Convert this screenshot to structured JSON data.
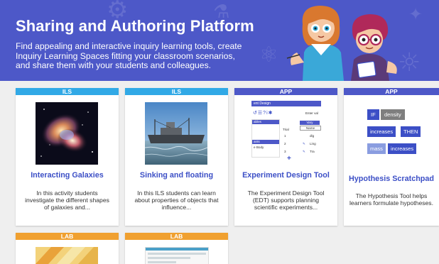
{
  "hero": {
    "title": "Sharing and Authoring Platform",
    "line1": "Find appealing and interactive inquiry learning tools, create",
    "line2": "Inquiry Learning Spaces fitting your classroom scenarios,",
    "line3": "and share them with your students and colleagues."
  },
  "cards": [
    {
      "tag": "ILS",
      "title": "Interacting Galaxies",
      "desc": [
        "In this activity students",
        "investigate the different shapes",
        "of galaxies and..."
      ]
    },
    {
      "tag": "ILS",
      "title": "Sinking and floating",
      "desc": [
        "In this ILS students can learn",
        "about properties of objects that",
        "influence..."
      ]
    },
    {
      "tag": "APP",
      "title": "Experiment Design Tool",
      "desc": [
        "The Experiment Design Tool",
        "(EDT) supports planning",
        "scientific experiments..."
      ]
    },
    {
      "tag": "APP",
      "title": "Hypothesis Scratchpad",
      "desc": [
        "The Hypothesis Tool helps",
        "learners formulate hypotheses."
      ]
    },
    {
      "tag": "LAB"
    },
    {
      "tag": "LAB"
    }
  ],
  "edt_thumb": {
    "header": "ent Design",
    "top_right": "Enter val",
    "label1": "ables",
    "label2": "ants",
    "label3": "e Body",
    "col_head": "Vary",
    "col_head2": "Name",
    "row_label": "Trial",
    "rows": [
      "1",
      "2",
      "3"
    ],
    "row_vals": [
      "dlg",
      "Ling",
      "Tra"
    ],
    "plus": "+"
  },
  "hyp_thumb": {
    "chips": [
      "IF",
      "density",
      "increases",
      "THEN",
      "mass",
      "increases"
    ]
  },
  "colors": {
    "hero_bg": "#4d58c8",
    "ils_tag": "#31a9e6",
    "app_tag": "#4d58c8",
    "lab_tag": "#f0a030",
    "title_blue": "#3c4fc6",
    "chip_blue": "#3c4fc6",
    "chip_grey": "#7f7f7f"
  }
}
